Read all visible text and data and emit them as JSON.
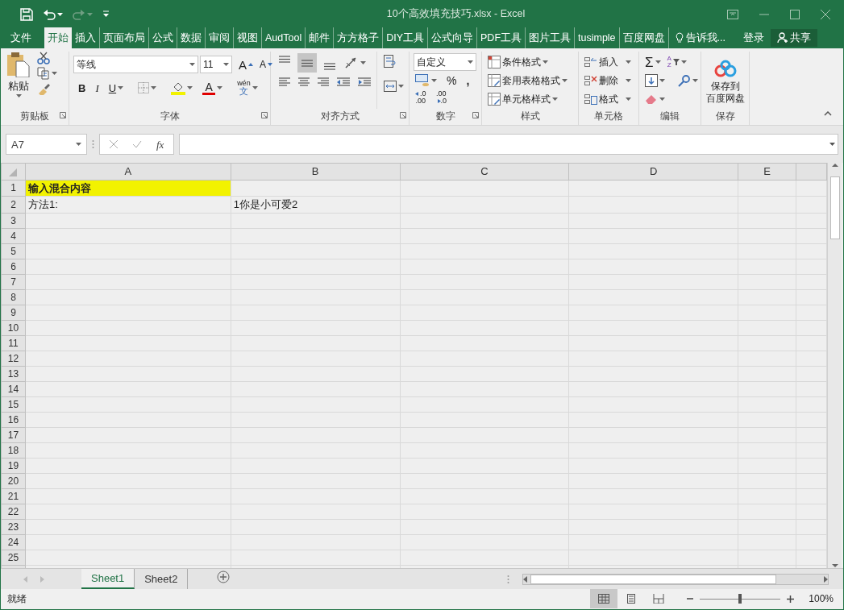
{
  "window": {
    "title": "10个高效填充技巧.xlsx - Excel"
  },
  "tabs": [
    {
      "label": "文件",
      "selected": false
    },
    {
      "label": "开始",
      "selected": true
    },
    {
      "label": "插入",
      "selected": false
    },
    {
      "label": "页面布局",
      "selected": false
    },
    {
      "label": "公式",
      "selected": false
    },
    {
      "label": "数据",
      "selected": false
    },
    {
      "label": "审阅",
      "selected": false
    },
    {
      "label": "视图",
      "selected": false
    },
    {
      "label": "AudTool",
      "selected": false
    },
    {
      "label": "邮件",
      "selected": false
    },
    {
      "label": "方方格子",
      "selected": false
    },
    {
      "label": "DIY工具",
      "selected": false
    },
    {
      "label": "公式向导",
      "selected": false
    },
    {
      "label": "PDF工具",
      "selected": false
    },
    {
      "label": "图片工具",
      "selected": false
    },
    {
      "label": "tusimple",
      "selected": false
    },
    {
      "label": "百度网盘",
      "selected": false
    }
  ],
  "tell_me": "告诉我...",
  "sign_in": "登录",
  "share": "共享",
  "ribbon": {
    "clipboard": {
      "label": "剪贴板",
      "paste": "粘贴"
    },
    "font": {
      "label": "字体",
      "font_name": "等线",
      "font_size": "11",
      "grow": "A",
      "shrink": "A",
      "bold": "B",
      "italic": "I",
      "underline": "U",
      "font_color": "A",
      "phonetic": "wén",
      "phonetic_char": "文"
    },
    "alignment": {
      "label": "对齐方式",
      "vertical": [
        {
          "selected": false
        },
        {
          "selected": true
        },
        {
          "selected": false
        }
      ]
    },
    "number": {
      "label": "数字",
      "format": "自定义",
      "percent": "%",
      "comma": ",",
      "increase_decimal": [
        ".0",
        ".00"
      ],
      "decrease_decimal": [
        ".00",
        ".0"
      ]
    },
    "styles": {
      "label": "样式",
      "buttons": [
        "条件格式",
        "套用表格格式",
        "单元格样式"
      ]
    },
    "cells": {
      "label": "单元格",
      "buttons": [
        "插入",
        "删除",
        "格式"
      ]
    },
    "editing": {
      "label": "编辑",
      "autosum": "Σ",
      "sort": [
        "A",
        "Z"
      ]
    },
    "save": {
      "label": "保存",
      "button": [
        "保存到",
        "百度网盘"
      ]
    }
  },
  "name_box": "A7",
  "function_icon": "fx",
  "sheet": {
    "columns": [
      "A",
      "B",
      "C",
      "D",
      "E"
    ],
    "rows": [
      {
        "header": "1",
        "cells": [
          {
            "text": "输入混合内容",
            "bold": true,
            "color": "#f2f200"
          }
        ]
      },
      {
        "header": "2",
        "cells": [
          {
            "text": "方法1:",
            "bold": false
          },
          {
            "text": "1你是小可爱2",
            "bold": false
          }
        ]
      },
      {
        "header": "3"
      },
      {
        "header": "4"
      },
      {
        "header": "5"
      },
      {
        "header": "6"
      },
      {
        "header": "7"
      },
      {
        "header": "8"
      },
      {
        "header": "9"
      },
      {
        "header": "10"
      },
      {
        "header": "11"
      },
      {
        "header": "12"
      },
      {
        "header": "13"
      },
      {
        "header": "14"
      },
      {
        "header": "15"
      },
      {
        "header": "16"
      },
      {
        "header": "17"
      },
      {
        "header": "18"
      },
      {
        "header": "19"
      },
      {
        "header": "20"
      },
      {
        "header": "21"
      },
      {
        "header": "22"
      },
      {
        "header": "23"
      },
      {
        "header": "24"
      },
      {
        "header": "25"
      }
    ]
  },
  "sheet_tabs": [
    {
      "label": "Sheet1",
      "selected": true
    },
    {
      "label": "Sheet2",
      "selected": false
    }
  ],
  "status": "就绪",
  "views": [
    {
      "kind": "normal",
      "selected": true
    },
    {
      "kind": "page_layout",
      "selected": false
    },
    {
      "kind": "page_break",
      "selected": false
    }
  ],
  "zoom": {
    "level": 0.5,
    "reading": "100%"
  }
}
